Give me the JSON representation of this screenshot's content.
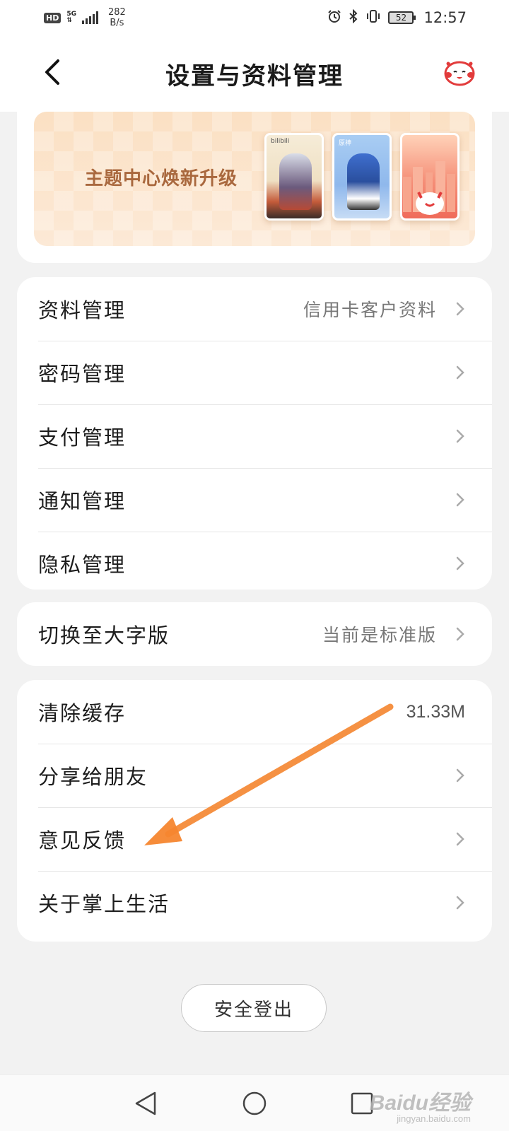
{
  "status_bar": {
    "hd": "HD",
    "network": "5G",
    "speed_value": "282",
    "speed_unit": "B/s",
    "battery": "52",
    "time": "12:57",
    "icons": [
      "alarm-icon",
      "bluetooth-icon",
      "vibrate-icon"
    ]
  },
  "header": {
    "title": "设置与资料管理",
    "back_icon": "chevron-left-icon",
    "mascot_icon": "cat-mascot-icon"
  },
  "banner": {
    "text": "主题中心焕新升级",
    "theme_labels": [
      "bilibili",
      "原神",
      ""
    ]
  },
  "group1": [
    {
      "label": "资料管理",
      "value": "信用卡客户资料"
    },
    {
      "label": "密码管理",
      "value": ""
    },
    {
      "label": "支付管理",
      "value": ""
    },
    {
      "label": "通知管理",
      "value": ""
    },
    {
      "label": "隐私管理",
      "value": ""
    }
  ],
  "group2": [
    {
      "label": "切换至大字版",
      "value": "当前是标准版"
    }
  ],
  "group3": [
    {
      "label": "清除缓存",
      "value": "31.33M"
    },
    {
      "label": "分享给朋友",
      "value": ""
    },
    {
      "label": "意见反馈",
      "value": ""
    },
    {
      "label": "关于掌上生活",
      "value": ""
    }
  ],
  "logout": "安全登出",
  "watermark": {
    "brand": "Baidu经验",
    "sub": "jingyan.baidu.com"
  },
  "colors": {
    "accent_arrow": "#f5862f",
    "banner_text": "#a9683e",
    "background": "#f2f2f2"
  }
}
